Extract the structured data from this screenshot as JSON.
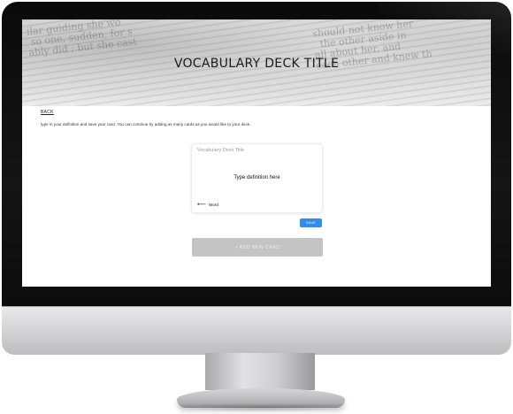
{
  "hero": {
    "title": "VOCABULARY DECK TITLE"
  },
  "nav": {
    "back_label": "BACK"
  },
  "instructions": "type in your definition and save your card. You can continue by adding as many cards as you would like to your deck.",
  "card": {
    "deck_title": "Vocabulary Deck Title",
    "definition_placeholder": "Type definition here",
    "word_label": "Word"
  },
  "actions": {
    "save_label": "SAVE",
    "add_card_label": "+ ADD NEW CARD"
  },
  "colors": {
    "save_button": "#2f8cf0",
    "add_button": "#c4c4c4"
  },
  "icons": {
    "word_arrow": "arrow-left-icon"
  }
}
